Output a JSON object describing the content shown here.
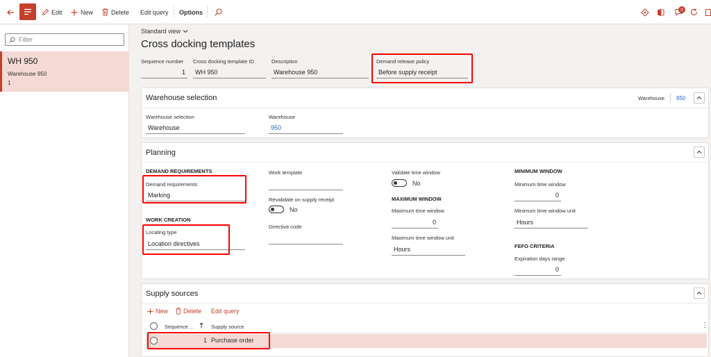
{
  "toolbar": {
    "edit_label": "Edit",
    "new_label": "New",
    "delete_label": "Delete",
    "edit_query_label": "Edit query",
    "options_label": "Options",
    "notification_count": "0"
  },
  "left_pane": {
    "filter_placeholder": "Filter",
    "items": [
      {
        "title": "WH 950",
        "subtitle": "Warehouse 950",
        "extra": "1"
      }
    ]
  },
  "header": {
    "view_label": "Standard view",
    "title": "Cross docking templates",
    "fields": {
      "seq_label": "Sequence number",
      "seq_value": "1",
      "template_label": "Cross docking template ID",
      "template_value": "WH 950",
      "desc_label": "Description",
      "desc_value": "Warehouse 950",
      "policy_label": "Demand release policy",
      "policy_value": "Before supply receipt"
    }
  },
  "warehouse_section": {
    "title": "Warehouse selection",
    "summary_label": "Warehouse",
    "summary_value": "950",
    "selection_label": "Warehouse selection",
    "selection_value": "Warehouse",
    "warehouse_label": "Warehouse",
    "warehouse_value": "950"
  },
  "planning_section": {
    "title": "Planning",
    "demand_header": "DEMAND REQUIREMENTS",
    "demand_label": "Demand requirements",
    "demand_value": "Marking",
    "work_creation_header": "WORK CREATION",
    "locating_label": "Locating type",
    "locating_value": "Location directives",
    "work_template_label": "Work template",
    "work_template_value": "",
    "revalidate_label": "Revalidate on supply receipt",
    "revalidate_value": "No",
    "directive_label": "Directive code",
    "directive_value": "",
    "validate_label": "Validate time window",
    "validate_value": "No",
    "max_header": "MAXIMUM WINDOW",
    "max_time_label": "Maximum time window",
    "max_time_value": "0",
    "max_unit_label": "Maximum time window unit",
    "max_unit_value": "Hours",
    "min_header": "MINIMUM WINDOW",
    "min_time_label": "Minimum time window",
    "min_time_value": "0",
    "min_unit_label": "Minimum time window unit",
    "min_unit_value": "Hours",
    "fefo_header": "FEFO CRITERIA",
    "expiration_label": "Expiration days range",
    "expiration_value": "0"
  },
  "supply_section": {
    "title": "Supply sources",
    "new_label": "New",
    "delete_label": "Delete",
    "edit_query_label": "Edit query",
    "col_sequence": "Sequence ...",
    "col_supply": "Supply source",
    "rows": [
      {
        "sequence": "1",
        "supply_source": "Purchase order"
      }
    ]
  },
  "colors": {
    "accent": "#c4402c",
    "highlight_box": "#ff0000",
    "link": "#2266c0",
    "selected_row": "#f4d9d4"
  }
}
